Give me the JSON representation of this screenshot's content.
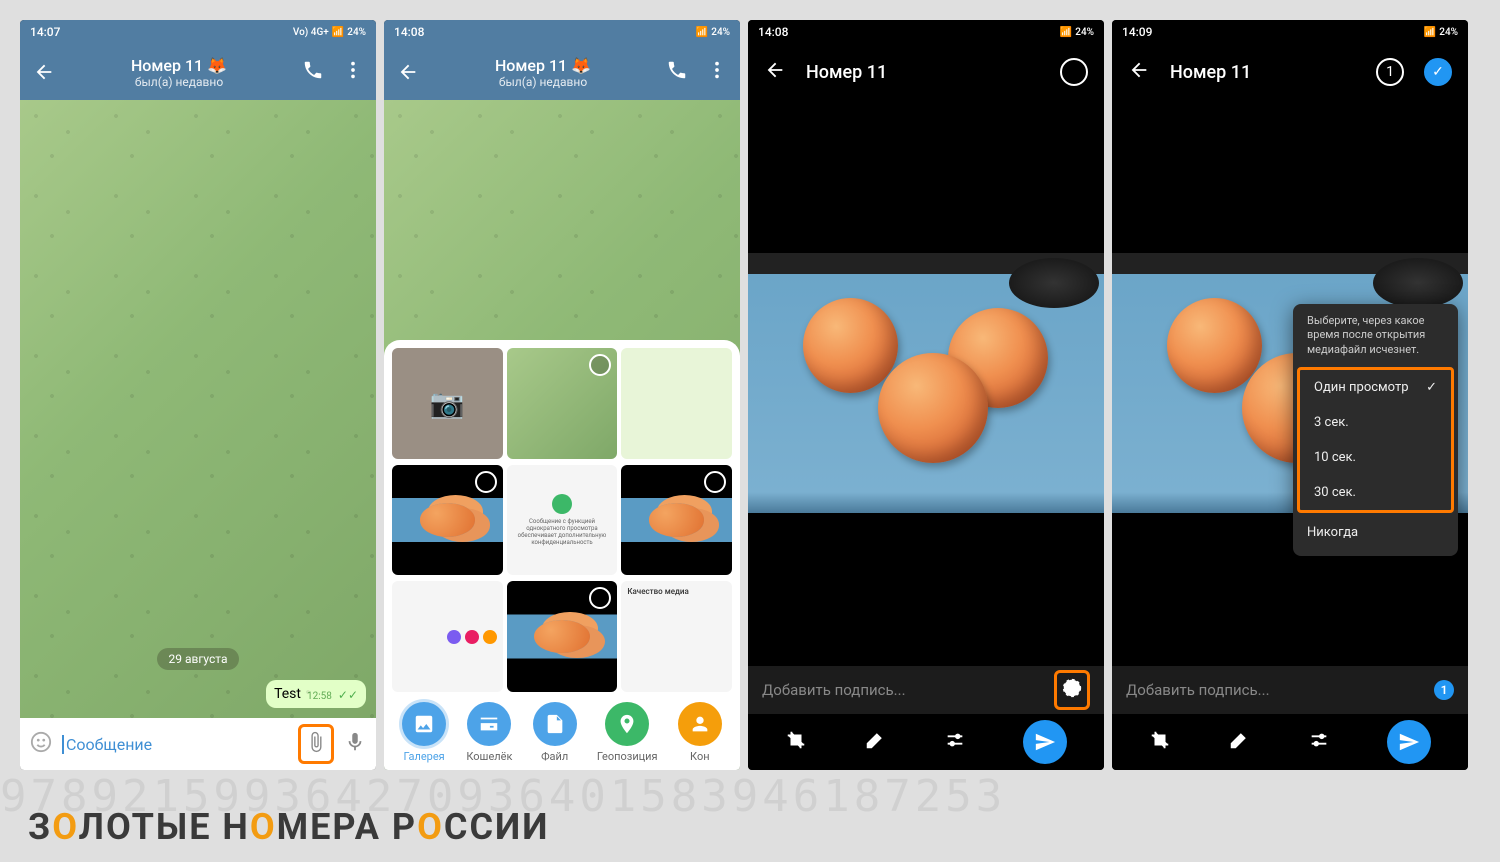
{
  "screen1": {
    "time": "14:07",
    "battery": "24%",
    "signal": "Vo) 4G+",
    "chat_title": "Номер 11",
    "chat_subtitle": "был(а) недавно",
    "date_label": "29 августа",
    "message_text": "Test",
    "message_time": "12:58",
    "input_placeholder": "Сообщение"
  },
  "screen2": {
    "time": "14:08",
    "battery": "24%",
    "chat_title": "Номер 11",
    "chat_subtitle": "был(а) недавно",
    "info_card_title": "Сообщение с функцией однократного просмотра обеспечивает дополнительную конфиденциальность",
    "quality_label": "Качество медиа",
    "tabs": {
      "gallery": "Галерея",
      "wallet": "Кошелёк",
      "file": "Файл",
      "geo": "Геопозиция",
      "contact": "Кон"
    }
  },
  "screen3": {
    "time": "14:08",
    "battery": "24%",
    "title": "Номер 11",
    "caption_placeholder": "Добавить подпись..."
  },
  "screen4": {
    "time": "14:09",
    "battery": "24%",
    "title": "Номер 11",
    "selected_count": "1",
    "caption_placeholder": "Добавить подпись...",
    "badge_count": "1",
    "timer_hint": "Выберите, через какое время после открытия медиафайл исчезнет.",
    "timer_options": {
      "once": "Один просмотр",
      "sec3": "3 сек.",
      "sec10": "10 сек.",
      "sec30": "30 сек.",
      "never": "Никогда"
    }
  },
  "watermark": {
    "numbers": "978921599364270936401583946187253",
    "text_parts": [
      "З",
      "О",
      "ЛОТЫЕ Н",
      "О",
      "МЕРА Р",
      "О",
      "ССИИ"
    ]
  }
}
